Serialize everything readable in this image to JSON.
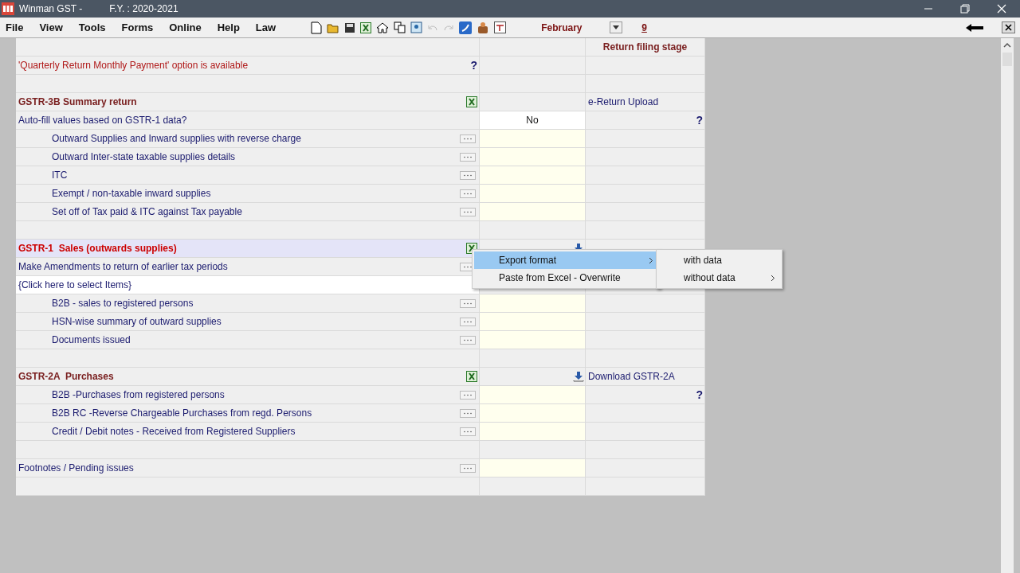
{
  "window": {
    "title": "Winman GST -",
    "fy": "F.Y. : 2020-2021"
  },
  "menu": [
    "File",
    "View",
    "Tools",
    "Forms",
    "Online",
    "Help",
    "Law"
  ],
  "period": {
    "month": "February",
    "day": "9"
  },
  "rows": [
    {
      "kind": "header",
      "stage": "Return filing stage"
    },
    {
      "kind": "note",
      "label": "'Quarterly Return Monthly Payment' option is available",
      "help": "?"
    },
    {
      "kind": "blank"
    },
    {
      "kind": "section",
      "label": "GSTR-3B Summary return",
      "selected": false,
      "download": false,
      "action": "e-Return Upload"
    },
    {
      "kind": "question",
      "label": "Auto-fill values based on GSTR-1 data?",
      "value": "No",
      "help": "?"
    },
    {
      "kind": "group",
      "children": [
        {
          "label": "Outward Supplies and Inward supplies with reverse charge"
        },
        {
          "label": "Outward Inter-state taxable supplies details"
        },
        {
          "label": "ITC"
        },
        {
          "label": "Exempt / non-taxable inward supplies"
        },
        {
          "label": "Set off of Tax paid & ITC against Tax payable"
        }
      ]
    },
    {
      "kind": "blank"
    },
    {
      "kind": "section",
      "label": "GSTR-1  Sales (outwards supplies)",
      "selected": true,
      "download": true
    },
    {
      "kind": "item",
      "label": "Make Amendments to return of earlier tax periods"
    },
    {
      "kind": "select",
      "label": "{Click here to select Items}"
    },
    {
      "kind": "group",
      "children": [
        {
          "label": "B2B - sales to registered persons"
        },
        {
          "label": "HSN-wise summary of outward supplies"
        },
        {
          "label": "Documents issued"
        }
      ]
    },
    {
      "kind": "blank"
    },
    {
      "kind": "section",
      "label": "GSTR-2A  Purchases",
      "selected": false,
      "download": true,
      "action": "Download GSTR-2A"
    },
    {
      "kind": "group",
      "children": [
        {
          "label": "B2B -Purchases from registered persons",
          "help": "?"
        },
        {
          "label": "B2B RC -Reverse Chargeable Purchases from regd. Persons"
        },
        {
          "label": "Credit / Debit notes - Received from Registered Suppliers"
        }
      ]
    },
    {
      "kind": "blank"
    },
    {
      "kind": "item",
      "label": "Footnotes / Pending issues"
    },
    {
      "kind": "blank"
    }
  ],
  "context_menu": {
    "items": [
      {
        "label": "Export format",
        "submenu": true,
        "selected": true
      },
      {
        "label": "Paste from Excel - Overwrite",
        "submenu": false,
        "selected": false
      }
    ],
    "submenu": [
      {
        "label": "with data",
        "submenu": false
      },
      {
        "label": "without data",
        "submenu": true
      }
    ]
  }
}
